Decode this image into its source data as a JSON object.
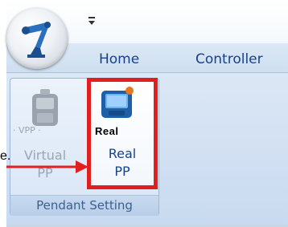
{
  "ribbon": {
    "tabs": [
      {
        "label": "Home"
      },
      {
        "label": "Controller"
      }
    ],
    "group": {
      "label": "Pendant Setting",
      "buttons": [
        {
          "label_line1": "Virtual",
          "label_line2": "PP",
          "icon": "virtual-pendant-icon",
          "tag": "· VPP ·",
          "state": "disabled"
        },
        {
          "label_line1": "Real",
          "label_line2": "PP",
          "icon": "real-pendant-icon",
          "tag": "Real",
          "state": "highlighted"
        }
      ]
    }
  },
  "annotation": {
    "partial_text": "e.",
    "highlight_color": "#e02020"
  },
  "colors": {
    "tab_text": "#15428b",
    "ribbon_bg": "#dce7f5"
  }
}
